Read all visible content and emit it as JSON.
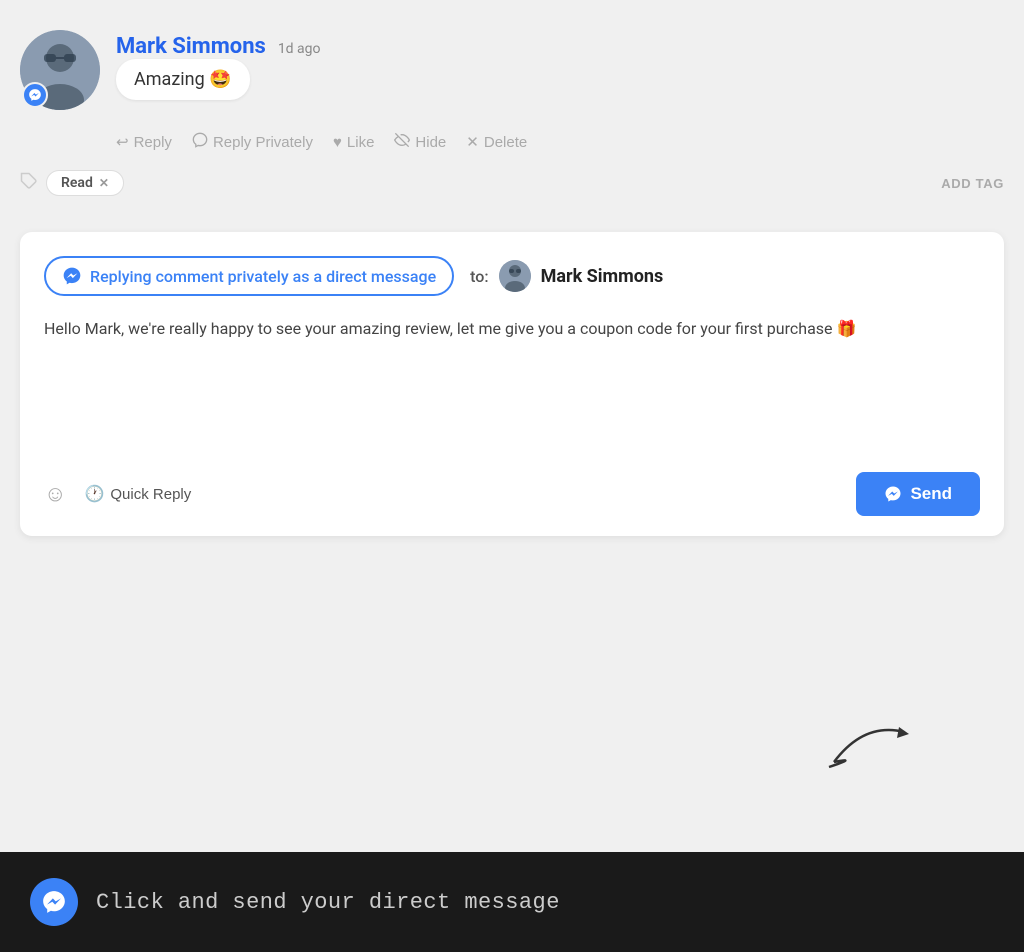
{
  "comment": {
    "author": "Mark Simmons",
    "time": "1d ago",
    "text": "Amazing 🤩",
    "actions": {
      "reply": "Reply",
      "reply_privately": "Reply Privately",
      "like": "Like",
      "hide": "Hide",
      "delete": "Delete"
    }
  },
  "tags": {
    "existing": "Read",
    "add_label": "ADD TAG"
  },
  "reply": {
    "type_label": "Replying comment privately as a direct message",
    "to_label": "to:",
    "to_name": "Mark Simmons",
    "body": "Hello Mark, we're really happy to see your amazing review, let me give you a coupon code for your first purchase 🎁",
    "quick_reply": "Quick Reply",
    "send": "Send"
  },
  "bottom_bar": {
    "text": "Click and send  your direct message"
  },
  "icons": {
    "reply": "↩",
    "reply_privately": "◎",
    "like": "♥",
    "hide": "🏷",
    "delete": "✕",
    "tag": "🏷",
    "emoji": "☺",
    "clock": "🕐",
    "messenger": "M"
  }
}
